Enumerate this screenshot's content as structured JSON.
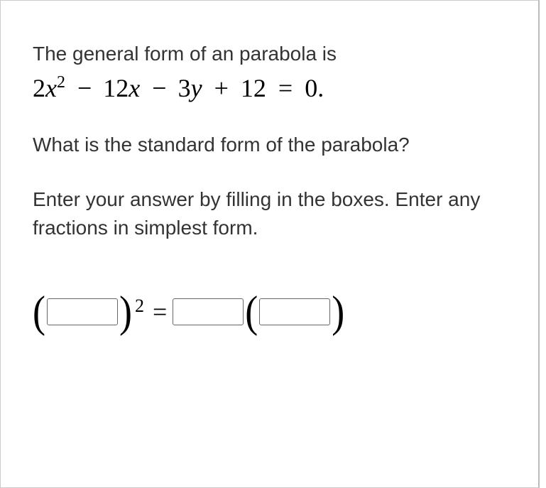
{
  "prompt": {
    "intro": "The general form of an parabola is",
    "equation_parts": {
      "t1": "2",
      "var1": "x",
      "exp1": "2",
      "op1": "−",
      "t2": "12",
      "var2": "x",
      "op2": "−",
      "t3": "3",
      "var3": "y",
      "op3": "+",
      "t4": "12",
      "eq": "=",
      "rhs": "0."
    }
  },
  "question": "What is the standard form of the parabola?",
  "instruction": "Enter your answer by filling in the boxes. Enter any fractions in simplest form.",
  "answer_template": {
    "lparen1": "(",
    "rparen1": ")",
    "exp": "2",
    "equals": "=",
    "lparen2": "(",
    "rparen2": ")",
    "box1_value": "",
    "box2_value": "",
    "box3_value": ""
  }
}
